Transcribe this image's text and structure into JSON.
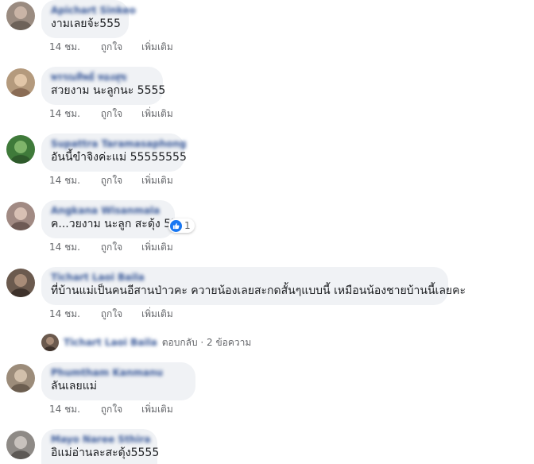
{
  "colors": {
    "bubble": "#f0f2f5",
    "name": "#385898",
    "meta": "#65676b",
    "text": "#1c1e21",
    "like_blue": "#1877f2"
  },
  "comments": [
    {
      "author": "Apichart Sinkeo",
      "text": "งามเลยจ้ะ555",
      "time": "14 ชม.",
      "like": "ถูกใจ",
      "more": "เพิ่มเติม"
    },
    {
      "author": "พรรณทิพย์ ทองสุข",
      "text": "สวยงาม นะลูกนะ 5555",
      "time": "14 ชม.",
      "like": "ถูกใจ",
      "more": "เพิ่มเติม"
    },
    {
      "author": "Supattra Taramasaphong",
      "text": "อันนี้ขำจิงค่ะแม่ 55555555",
      "time": "14 ชม.",
      "like": "ถูกใจ",
      "more": "เพิ่มเติม"
    },
    {
      "author": "Angkana Wisanmala",
      "text": "ค...วยงาม นะลูก สะดุ้ง 55",
      "time": "14 ชม.",
      "like": "ถูกใจ",
      "more": "เพิ่มเติม",
      "reaction_count": "1",
      "reaction_icon": "like-icon"
    },
    {
      "author": "Tichart Laoi Baila",
      "text": "ที่บ้านแม่เป็นคนอีสานป่าวคะ ควายน้องเลยสะกดสั้นๆแบบนี้ เหมือนน้องชายบ้านนี้เลยคะ",
      "time": "14 ชม.",
      "like": "ถูกใจ",
      "more": "เพิ่มเติม"
    },
    {
      "author": "Phumtham Kanmanu",
      "text": "ลันเลยแม่",
      "time": "14 ชม.",
      "like": "ถูกใจ",
      "more": "เพิ่มเติม"
    },
    {
      "author": "Mayo Naree Sthira",
      "text": "อิแม่อ่านละสะดุ้ง5555"
    }
  ],
  "reply": {
    "name": "Tichart Laoi Baila",
    "text": "ตอบกลับ · 2 ข้อความ"
  }
}
